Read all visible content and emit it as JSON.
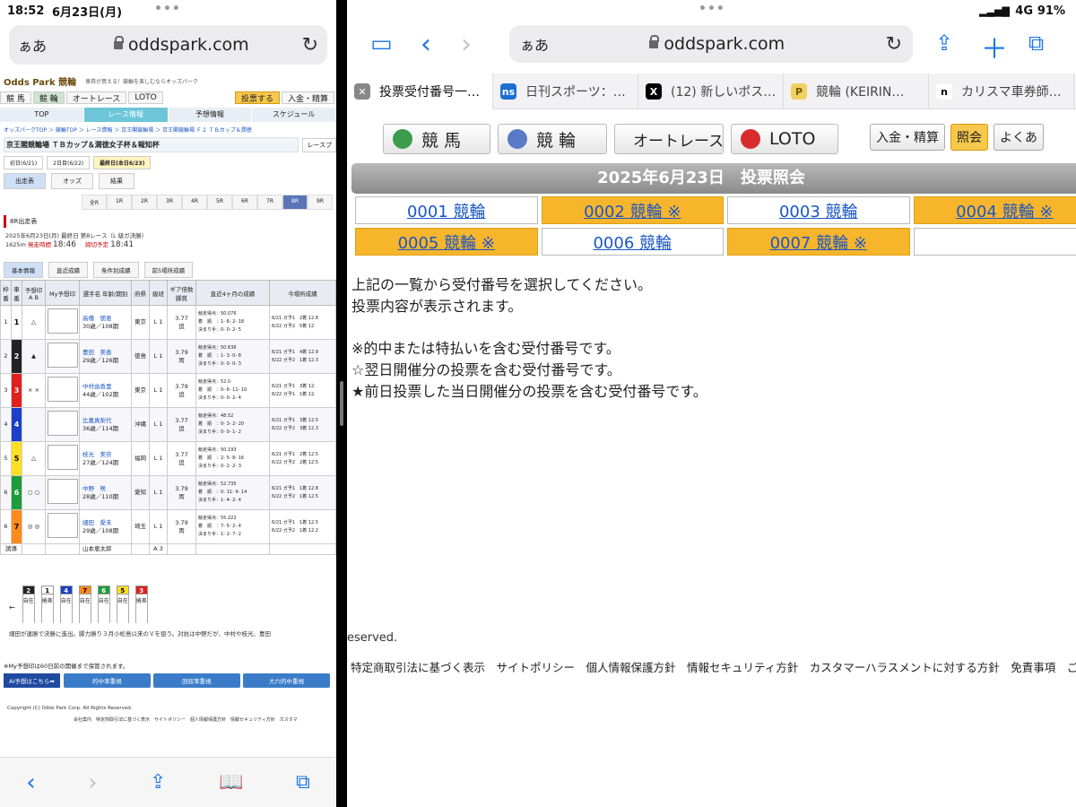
{
  "left": {
    "status_time": "18:52",
    "status_date": "6月23日(月)",
    "url_aa": "ぁあ",
    "url_host": "oddspark.com",
    "site": {
      "logo": "Odds Park 競輪",
      "tagline": "車券が買える！競輪を楽しむならオッズパーク",
      "tabs": [
        "競 馬",
        "競 輪",
        "オートレース",
        "LOTO"
      ],
      "tab_buy": "投票する",
      "tab_deposit": "入金・精算",
      "menu": [
        "TOP",
        "レース情報",
        "予想情報",
        "スケジュール"
      ],
      "breadcrumb": "オッズパークTOP ＞ 競輪TOP ＞ レース情報 ＞ 京王閣競輪場 ＞ 京王閣競輪場 Ｆ２ ＴＢカップ＆潤徳",
      "race_title": "京王閣競輪場 ＴＢカップ＆潤徳女子杯＆報知杯",
      "race_title_link": "レースプ",
      "days": [
        "初日(6/21)",
        "2日目(6/22)",
        "最終日(本日6/23)"
      ],
      "subtabs": [
        "出走表",
        "オッズ",
        "結果"
      ],
      "races": [
        "全R",
        "1R",
        "2R",
        "3R",
        "4R",
        "5R",
        "6R",
        "7R",
        "8R",
        "9R"
      ],
      "section": "8R出走表",
      "info_line1": "2025年6月23日(月) 最終日 第8レース（L 級ガ決勝）",
      "info_distance": "1625m",
      "info_start_label": "発走時間",
      "info_start": "18:46",
      "info_close_label": "締切予定",
      "info_close": "18:41",
      "info_tabs": [
        "基本情報",
        "直近成績",
        "条件別成績",
        "前5場所成績"
      ],
      "table_headers": [
        "枠番",
        "車番",
        "予想印 A B",
        "My予想印",
        "選手名 年齢/期別",
        "府県",
        "級班",
        "ギア倍数 脚質",
        "直近4ヶ月の成績",
        "今場所成績"
      ],
      "racers": [
        {
          "waku": "1",
          "car": "1",
          "a": "",
          "b": "△",
          "name": "高橋　朋恵",
          "age": "30歳／108期",
          "pref": "東京",
          "cls": "L 1",
          "gear": "3.77",
          "style": "追",
          "score": "競走得点：50.076",
          "place": "着　順　：1- 6- 2- 18",
          "kimari": "決まり手：0- 0- 2- 5",
          "today": "6/21 ガ予1　2着 12.8",
          "today2": "6/22 ガ予2　5着 12",
          "color": "#ffffff",
          "fg": "#000"
        },
        {
          "waku": "2",
          "car": "2",
          "a": "▲",
          "b": "",
          "name": "豊田　美香",
          "age": "29歳／126期",
          "pref": "徳島",
          "cls": "L 1",
          "gear": "3.79",
          "style": "両",
          "score": "競走得点：50.636",
          "place": "着　順　：1- 3- 0- 8",
          "kimari": "決まり手：0- 0- 0- 3",
          "today": "6/21 ガ予1　4着 12.9",
          "today2": "6/22 ガ予2　1着 12.3",
          "color": "#222222",
          "fg": "#fff"
        },
        {
          "waku": "3",
          "car": "3",
          "a": "×",
          "b": "×",
          "name": "中村由香里",
          "age": "44歳／102期",
          "pref": "東京",
          "cls": "L 1",
          "gear": "3.79",
          "style": "追",
          "score": "競走得点：52.0",
          "place": "着　順　：0- 6- 11- 10",
          "kimari": "決まり手：0- 0- 2- 4",
          "today": "6/21 ガ予1　3着 12.",
          "today2": "6/22 ガ予1　1着 12.",
          "color": "#e0201c",
          "fg": "#fff"
        },
        {
          "waku": "4",
          "car": "4",
          "a": "",
          "b": "",
          "name": "比嘉真梨代",
          "age": "36歳／114期",
          "pref": "沖縄",
          "cls": "L 1",
          "gear": "3.77",
          "style": "追",
          "score": "競走得点：48.52",
          "place": "着　順　：0- 3- 2- 20",
          "kimari": "決まり手：0- 0- 1- 2",
          "today": "6/21 ガ予1　3着 12.5",
          "today2": "6/22 ガ予2　3着 12.3",
          "color": "#1a3fc8",
          "fg": "#fff"
        },
        {
          "waku": "5",
          "car": "5",
          "a": "△",
          "b": "",
          "name": "枝光　美奈",
          "age": "27歳／124期",
          "pref": "福岡",
          "cls": "L 1",
          "gear": "3.77",
          "style": "追",
          "score": "競走得点：50.193",
          "place": "着　順　：2- 5- 8- 16",
          "kimari": "決まり手：0- 2- 2- 3",
          "today": "6/21 ガ予1　2着 12.5",
          "today2": "6/22 ガ予2　2着 12.5",
          "color": "#ffe020",
          "fg": "#000"
        },
        {
          "waku": "6",
          "car": "6",
          "a": "○",
          "b": "○",
          "name": "中野　咲",
          "age": "28歳／110期",
          "pref": "愛知",
          "cls": "L 1",
          "gear": "3.79",
          "style": "両",
          "score": "競走得点：52.735",
          "place": "着　順　：0- 11- 9- 14",
          "kimari": "決まり手：1- 4- 2- 4",
          "today": "6/21 ガ予1　1着 12.8",
          "today2": "6/22 ガ予2　1着 12.5",
          "color": "#1c9c3c",
          "fg": "#fff"
        },
        {
          "waku": "6",
          "car": "7",
          "a": "◎",
          "b": "◎",
          "name": "細田　愛未",
          "age": "29歳／108期",
          "pref": "埼玉",
          "cls": "L 1",
          "gear": "3.79",
          "style": "両",
          "score": "競走得点：55.222",
          "place": "着　順　：7- 5- 2- 4",
          "kimari": "決まり手：1- 2- 7- 2",
          "today": "6/21 ガ予1　1着 12.5",
          "today2": "6/22 ガ予2　1着 12.2",
          "color": "#ff8a1c",
          "fg": "#000"
        }
      ],
      "yudo_label": "誘導",
      "yudo_name": "山本恵太郎",
      "yudo_cls": "A 3",
      "ships": [
        {
          "n": "2",
          "v": "自在",
          "color": "#222",
          "fg": "#fff"
        },
        {
          "n": "1",
          "v": "捲差",
          "color": "#fff",
          "fg": "#000"
        },
        {
          "n": "4",
          "v": "自在",
          "color": "#1a3fc8",
          "fg": "#fff"
        },
        {
          "n": "7",
          "v": "自在",
          "color": "#ff8a1c",
          "fg": "#000"
        },
        {
          "n": "6",
          "v": "自在",
          "color": "#1c9c3c",
          "fg": "#fff"
        },
        {
          "n": "5",
          "v": "自在",
          "color": "#ffe020",
          "fg": "#000"
        },
        {
          "n": "3",
          "v": "捲差",
          "color": "#e0201c",
          "fg": "#fff"
        }
      ],
      "ship_arrow": "←",
      "comment": "細田が連勝で決勝に進出。脚力勝り３月小松島以来のＶを狙う。対抗は中野だが、中村や枝光、豊田",
      "my_note": "※My予想印は60日前の開催まで保管されます。",
      "ai_button": "AI予想はこちら➡",
      "ai_tabs": [
        "的中率重視",
        "回収率重視",
        "大穴的中重視"
      ],
      "copyright": "Copyright (C) Odds Park Corp. All Rights Reserved.",
      "footer_links": "会社案内　特定商取引法に基づく表示　サイトポリシー　個人情報保護方針　情報セキュリティ方針　カスタマ"
    }
  },
  "right": {
    "status_signal": "4G",
    "status_battery": "91%",
    "url_aa": "ぁあ",
    "url_host": "oddspark.com",
    "tabs": [
      {
        "title": "投票受付番号一…",
        "fav": "✕",
        "favbg": "#888",
        "favfg": "#fff"
      },
      {
        "title": "日刊スポーツ：…",
        "fav": "ns",
        "favbg": "#1a6fd0",
        "favfg": "#fff"
      },
      {
        "title": "(12) 新しいポス…",
        "fav": "X",
        "favbg": "#000",
        "favfg": "#fff"
      },
      {
        "title": "競輪 (KEIRIN…",
        "fav": "P",
        "favbg": "#f0d060",
        "favfg": "#7a5a00"
      },
      {
        "title": "カリスマ車券師…",
        "fav": "n",
        "favbg": "#fff",
        "favfg": "#000"
      }
    ],
    "nav": [
      "競 馬",
      "競 輪",
      "オートレース",
      "LOTO"
    ],
    "util": [
      "入金・精算",
      "照会",
      "よくあ"
    ],
    "date_title": "2025年6月23日　投票照会",
    "receipts": [
      [
        {
          "label": "0001 競輪",
          "hi": false
        },
        {
          "label": "0002 競輪 ※",
          "hi": true
        },
        {
          "label": "0003 競輪",
          "hi": false
        },
        {
          "label": "0004 競輪 ※",
          "hi": true
        }
      ],
      [
        {
          "label": "0005 競輪 ※",
          "hi": true
        },
        {
          "label": "0006 競輪",
          "hi": false
        },
        {
          "label": "0007 競輪 ※",
          "hi": true
        },
        {
          "label": "",
          "hi": false
        }
      ]
    ],
    "instr1": "上記の一覧から受付番号を選択してください。",
    "instr2": "投票内容が表示されます。",
    "legend1": "※的中または特払いを含む受付番号です。",
    "legend2": "☆翌日開催分の投票を含む受付番号です。",
    "legend3": "★前日投票した当日開催分の投票を含む受付番号です。",
    "reserved": "eserved.",
    "footer": "特定商取引法に基づく表示　サイトポリシー　個人情報保護方針　情報セキュリティ方針　カスタマーハラスメントに対する方針　免責事項　ご意見・ご要"
  },
  "colors": {
    "accent": "#1a74e8",
    "highlight": "#f7b52c",
    "link": "#1a56c4"
  }
}
